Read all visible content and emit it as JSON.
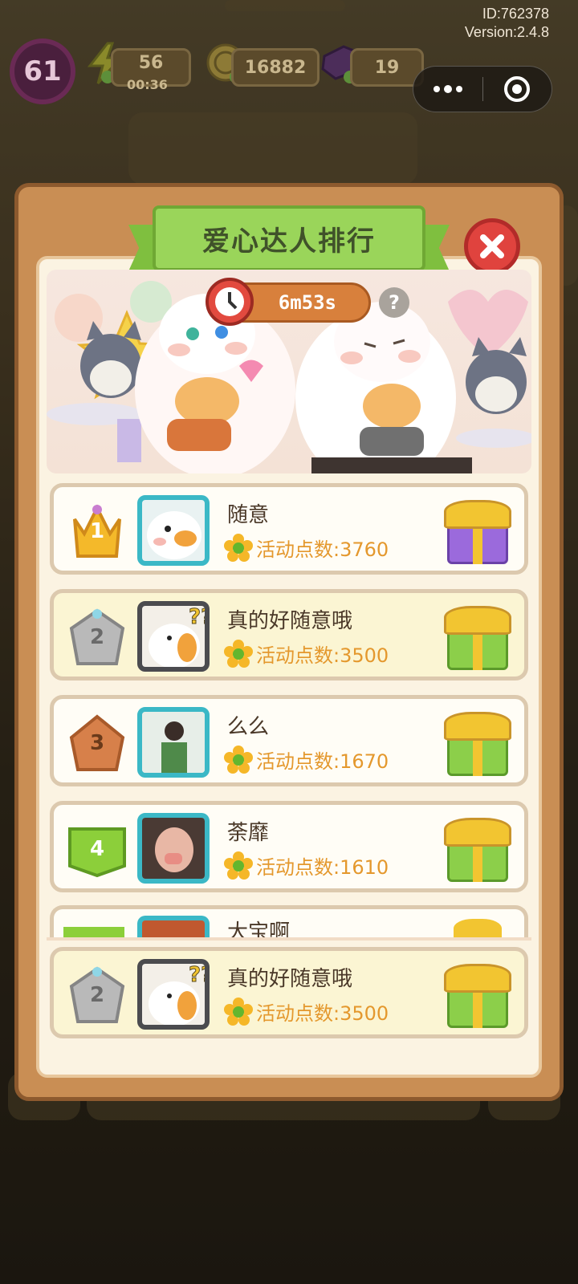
{
  "hud": {
    "level": "61",
    "energy": "56",
    "energy_timer": "00:36",
    "coins": "16882",
    "gems": "19"
  },
  "system": {
    "id_text": "ID:762378",
    "version_text": "Version:2.4.8"
  },
  "popup": {
    "title": "爱心达人排行",
    "timer": "6m53s",
    "help": "?"
  },
  "leaderboard": [
    {
      "rank": "1",
      "name": "随意",
      "score": "活动点数:3760",
      "gift": "purple"
    },
    {
      "rank": "2",
      "name": "真的好随意哦",
      "score": "活动点数:3500",
      "gift": "green"
    },
    {
      "rank": "3",
      "name": "么么",
      "score": "活动点数:1670",
      "gift": "green"
    },
    {
      "rank": "4",
      "name": "荼靡",
      "score": "活动点数:1610",
      "gift": "green"
    }
  ],
  "partial_row": {
    "name": "大宝啊"
  },
  "my_rank": {
    "rank": "2",
    "name": "真的好随意哦",
    "score": "活动点数:3500",
    "gift": "green"
  },
  "colors": {
    "panel": "#c98e54",
    "ribbon": "#9ad55a",
    "close": "#e0433e",
    "score": "#e4982d",
    "gold_badge": "#f4b92a",
    "silver_badge": "#a8a8a8",
    "bronze_badge": "#d7804a",
    "green_badge": "#8ccf3a"
  }
}
